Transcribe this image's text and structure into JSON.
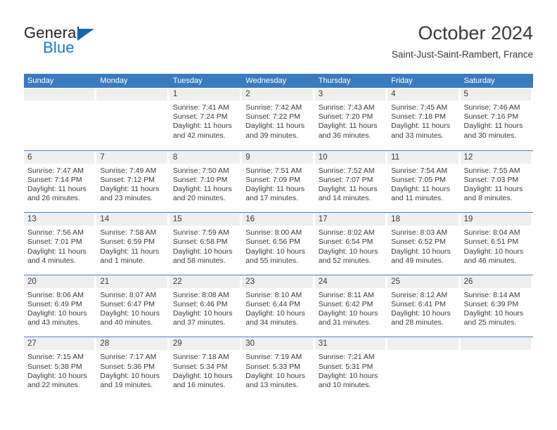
{
  "brand": {
    "name_top": "General",
    "name_bottom": "Blue",
    "accent_color": "#1a7ac4",
    "triangle_color": "#1565b0"
  },
  "header": {
    "title": "October 2024",
    "subtitle": "Saint-Just-Saint-Rambert, France"
  },
  "theme": {
    "header_blue": "#3a7bbf",
    "day_band_gray": "#efefef",
    "text_color": "#3b3b3b"
  },
  "weekdays": [
    "Sunday",
    "Monday",
    "Tuesday",
    "Wednesday",
    "Thursday",
    "Friday",
    "Saturday"
  ],
  "weeks": [
    [
      {
        "day": "",
        "empty": true,
        "sunrise": "",
        "sunset": "",
        "daylight_1": "",
        "daylight_2": ""
      },
      {
        "day": "",
        "empty": true,
        "sunrise": "",
        "sunset": "",
        "daylight_1": "",
        "daylight_2": ""
      },
      {
        "day": "1",
        "empty": false,
        "sunrise": "Sunrise: 7:41 AM",
        "sunset": "Sunset: 7:24 PM",
        "daylight_1": "Daylight: 11 hours",
        "daylight_2": "and 42 minutes."
      },
      {
        "day": "2",
        "empty": false,
        "sunrise": "Sunrise: 7:42 AM",
        "sunset": "Sunset: 7:22 PM",
        "daylight_1": "Daylight: 11 hours",
        "daylight_2": "and 39 minutes."
      },
      {
        "day": "3",
        "empty": false,
        "sunrise": "Sunrise: 7:43 AM",
        "sunset": "Sunset: 7:20 PM",
        "daylight_1": "Daylight: 11 hours",
        "daylight_2": "and 36 minutes."
      },
      {
        "day": "4",
        "empty": false,
        "sunrise": "Sunrise: 7:45 AM",
        "sunset": "Sunset: 7:18 PM",
        "daylight_1": "Daylight: 11 hours",
        "daylight_2": "and 33 minutes."
      },
      {
        "day": "5",
        "empty": false,
        "sunrise": "Sunrise: 7:46 AM",
        "sunset": "Sunset: 7:16 PM",
        "daylight_1": "Daylight: 11 hours",
        "daylight_2": "and 30 minutes."
      }
    ],
    [
      {
        "day": "6",
        "empty": false,
        "sunrise": "Sunrise: 7:47 AM",
        "sunset": "Sunset: 7:14 PM",
        "daylight_1": "Daylight: 11 hours",
        "daylight_2": "and 26 minutes."
      },
      {
        "day": "7",
        "empty": false,
        "sunrise": "Sunrise: 7:49 AM",
        "sunset": "Sunset: 7:12 PM",
        "daylight_1": "Daylight: 11 hours",
        "daylight_2": "and 23 minutes."
      },
      {
        "day": "8",
        "empty": false,
        "sunrise": "Sunrise: 7:50 AM",
        "sunset": "Sunset: 7:10 PM",
        "daylight_1": "Daylight: 11 hours",
        "daylight_2": "and 20 minutes."
      },
      {
        "day": "9",
        "empty": false,
        "sunrise": "Sunrise: 7:51 AM",
        "sunset": "Sunset: 7:09 PM",
        "daylight_1": "Daylight: 11 hours",
        "daylight_2": "and 17 minutes."
      },
      {
        "day": "10",
        "empty": false,
        "sunrise": "Sunrise: 7:52 AM",
        "sunset": "Sunset: 7:07 PM",
        "daylight_1": "Daylight: 11 hours",
        "daylight_2": "and 14 minutes."
      },
      {
        "day": "11",
        "empty": false,
        "sunrise": "Sunrise: 7:54 AM",
        "sunset": "Sunset: 7:05 PM",
        "daylight_1": "Daylight: 11 hours",
        "daylight_2": "and 11 minutes."
      },
      {
        "day": "12",
        "empty": false,
        "sunrise": "Sunrise: 7:55 AM",
        "sunset": "Sunset: 7:03 PM",
        "daylight_1": "Daylight: 11 hours",
        "daylight_2": "and 8 minutes."
      }
    ],
    [
      {
        "day": "13",
        "empty": false,
        "sunrise": "Sunrise: 7:56 AM",
        "sunset": "Sunset: 7:01 PM",
        "daylight_1": "Daylight: 11 hours",
        "daylight_2": "and 4 minutes."
      },
      {
        "day": "14",
        "empty": false,
        "sunrise": "Sunrise: 7:58 AM",
        "sunset": "Sunset: 6:59 PM",
        "daylight_1": "Daylight: 11 hours",
        "daylight_2": "and 1 minute."
      },
      {
        "day": "15",
        "empty": false,
        "sunrise": "Sunrise: 7:59 AM",
        "sunset": "Sunset: 6:58 PM",
        "daylight_1": "Daylight: 10 hours",
        "daylight_2": "and 58 minutes."
      },
      {
        "day": "16",
        "empty": false,
        "sunrise": "Sunrise: 8:00 AM",
        "sunset": "Sunset: 6:56 PM",
        "daylight_1": "Daylight: 10 hours",
        "daylight_2": "and 55 minutes."
      },
      {
        "day": "17",
        "empty": false,
        "sunrise": "Sunrise: 8:02 AM",
        "sunset": "Sunset: 6:54 PM",
        "daylight_1": "Daylight: 10 hours",
        "daylight_2": "and 52 minutes."
      },
      {
        "day": "18",
        "empty": false,
        "sunrise": "Sunrise: 8:03 AM",
        "sunset": "Sunset: 6:52 PM",
        "daylight_1": "Daylight: 10 hours",
        "daylight_2": "and 49 minutes."
      },
      {
        "day": "19",
        "empty": false,
        "sunrise": "Sunrise: 8:04 AM",
        "sunset": "Sunset: 6:51 PM",
        "daylight_1": "Daylight: 10 hours",
        "daylight_2": "and 46 minutes."
      }
    ],
    [
      {
        "day": "20",
        "empty": false,
        "sunrise": "Sunrise: 8:06 AM",
        "sunset": "Sunset: 6:49 PM",
        "daylight_1": "Daylight: 10 hours",
        "daylight_2": "and 43 minutes."
      },
      {
        "day": "21",
        "empty": false,
        "sunrise": "Sunrise: 8:07 AM",
        "sunset": "Sunset: 6:47 PM",
        "daylight_1": "Daylight: 10 hours",
        "daylight_2": "and 40 minutes."
      },
      {
        "day": "22",
        "empty": false,
        "sunrise": "Sunrise: 8:08 AM",
        "sunset": "Sunset: 6:46 PM",
        "daylight_1": "Daylight: 10 hours",
        "daylight_2": "and 37 minutes."
      },
      {
        "day": "23",
        "empty": false,
        "sunrise": "Sunrise: 8:10 AM",
        "sunset": "Sunset: 6:44 PM",
        "daylight_1": "Daylight: 10 hours",
        "daylight_2": "and 34 minutes."
      },
      {
        "day": "24",
        "empty": false,
        "sunrise": "Sunrise: 8:11 AM",
        "sunset": "Sunset: 6:42 PM",
        "daylight_1": "Daylight: 10 hours",
        "daylight_2": "and 31 minutes."
      },
      {
        "day": "25",
        "empty": false,
        "sunrise": "Sunrise: 8:12 AM",
        "sunset": "Sunset: 6:41 PM",
        "daylight_1": "Daylight: 10 hours",
        "daylight_2": "and 28 minutes."
      },
      {
        "day": "26",
        "empty": false,
        "sunrise": "Sunrise: 8:14 AM",
        "sunset": "Sunset: 6:39 PM",
        "daylight_1": "Daylight: 10 hours",
        "daylight_2": "and 25 minutes."
      }
    ],
    [
      {
        "day": "27",
        "empty": false,
        "sunrise": "Sunrise: 7:15 AM",
        "sunset": "Sunset: 5:38 PM",
        "daylight_1": "Daylight: 10 hours",
        "daylight_2": "and 22 minutes."
      },
      {
        "day": "28",
        "empty": false,
        "sunrise": "Sunrise: 7:17 AM",
        "sunset": "Sunset: 5:36 PM",
        "daylight_1": "Daylight: 10 hours",
        "daylight_2": "and 19 minutes."
      },
      {
        "day": "29",
        "empty": false,
        "sunrise": "Sunrise: 7:18 AM",
        "sunset": "Sunset: 5:34 PM",
        "daylight_1": "Daylight: 10 hours",
        "daylight_2": "and 16 minutes."
      },
      {
        "day": "30",
        "empty": false,
        "sunrise": "Sunrise: 7:19 AM",
        "sunset": "Sunset: 5:33 PM",
        "daylight_1": "Daylight: 10 hours",
        "daylight_2": "and 13 minutes."
      },
      {
        "day": "31",
        "empty": false,
        "sunrise": "Sunrise: 7:21 AM",
        "sunset": "Sunset: 5:31 PM",
        "daylight_1": "Daylight: 10 hours",
        "daylight_2": "and 10 minutes."
      },
      {
        "day": "",
        "empty": true,
        "sunrise": "",
        "sunset": "",
        "daylight_1": "",
        "daylight_2": ""
      },
      {
        "day": "",
        "empty": true,
        "sunrise": "",
        "sunset": "",
        "daylight_1": "",
        "daylight_2": ""
      }
    ]
  ]
}
